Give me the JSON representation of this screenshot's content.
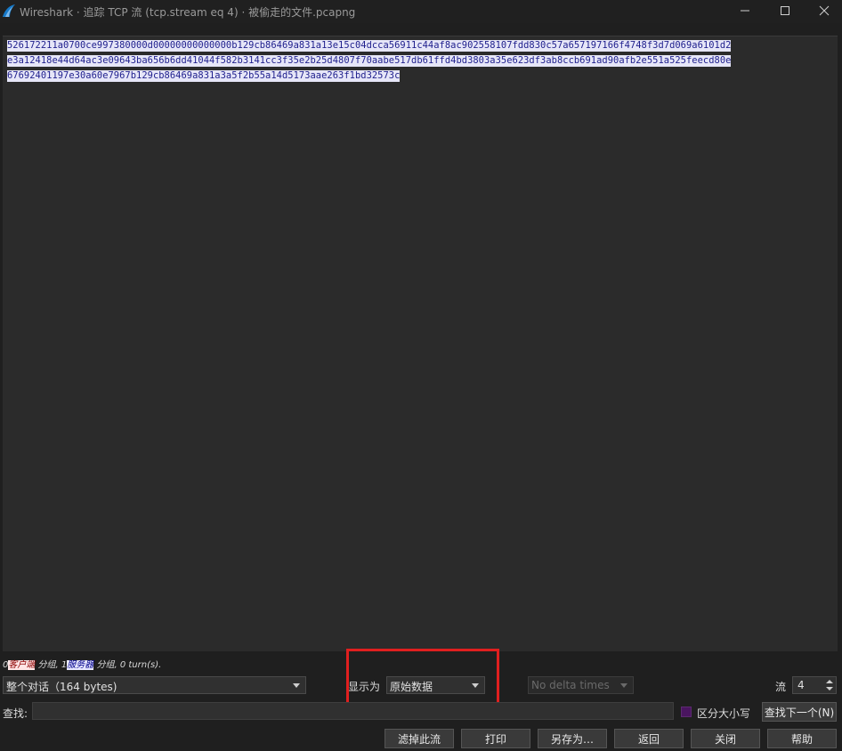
{
  "window": {
    "title": "Wireshark · 追踪 TCP 流 (tcp.stream eq 4) · 被偷走的文件.pcapng"
  },
  "stream": {
    "lines": [
      "526172211a0700ce997380000d00000000000000b129cb86469a831a13e15c04dcca56911c44af8ac902558107fdd830c57a657197166f4748f3d7d069a6101d2",
      "e3a12418e44d64ac3e09643ba656b6dd41044f582b3141cc3f35e2b25d4807f70aabe517db61ffd4bd3803a35e623df3ab8ccb691ad90afb2e551a525feecd80e",
      "67692401197e30a60e7967b129cb86469a831a3a5f2b55a14d5173aae263f1bd32573c"
    ]
  },
  "status": {
    "client_count": "0",
    "client_label": "客户端",
    "client_suffix": " 分组, ",
    "server_count": "1",
    "server_label": "服务器",
    "server_suffix": " 分组, 0 turn(s)."
  },
  "controls": {
    "conversation": "整个对话（164 bytes)",
    "show_as_label": "显示为",
    "show_as_value": "原始数据",
    "delta_times": "No delta times",
    "stream_label": "流",
    "stream_value": "4",
    "find_label": "查找:",
    "find_value": "",
    "case_label": "区分大小写",
    "find_next": "查找下一个(N)"
  },
  "buttons": {
    "filter_out": "滤掉此流",
    "print": "打印",
    "save_as": "另存为…",
    "back": "返回",
    "close": "关闭",
    "help": "帮助"
  },
  "colors": {
    "client_text": "#8b0000",
    "server_text": "#00008b",
    "highlight_box": "#e01f1f"
  }
}
